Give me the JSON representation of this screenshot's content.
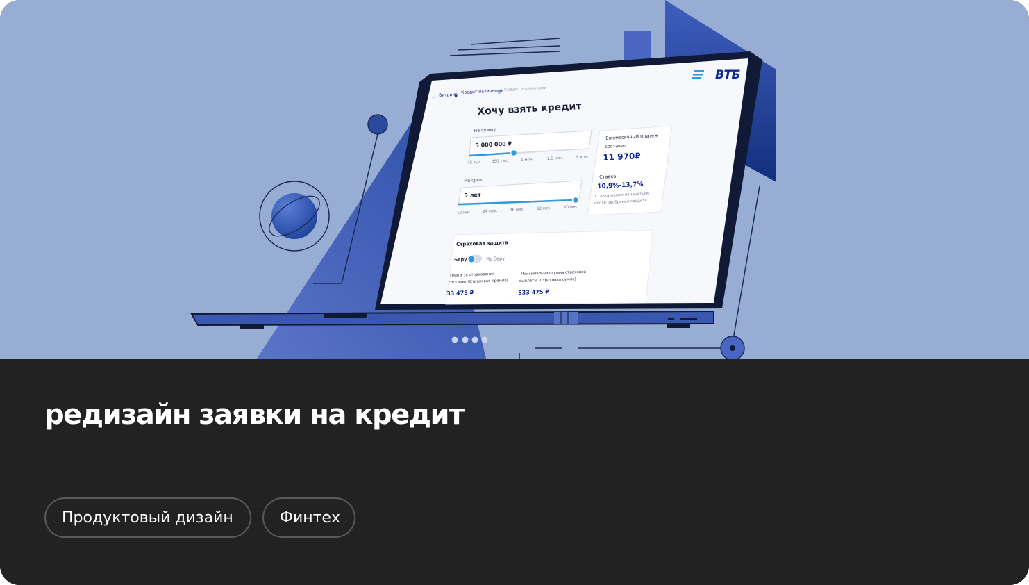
{
  "hero": {
    "brand_logo": "ВТБ",
    "breadcrumb": [
      "Витрина",
      "Кредит наличными",
      "Кредит наличными"
    ],
    "form_title": "Хочу взять кредит",
    "amount": {
      "label": "На сумму",
      "value": "5 000 000 ₽",
      "ticks": [
        "75 тыс.",
        "350 тыс.",
        "1 млн.",
        "2,5 млн.",
        "5 млн."
      ]
    },
    "term": {
      "label": "На срок",
      "value": "5 лет",
      "ticks": [
        "12 мес.",
        "24 мес.",
        "36 мес.",
        "62 мес.",
        "60 мес."
      ]
    },
    "summary": {
      "payment_label_1": "Ежемесячный платеж",
      "payment_label_2": "составит",
      "payment_value": "11 970₽",
      "rate_label": "Ставка",
      "rate_value": "10,9%-13,7%",
      "rate_note_1": "Ставка может измениться",
      "rate_note_2": "после одобрения кредита"
    },
    "insurance": {
      "title": "Страховая защита",
      "toggle_on_label": "Беру",
      "toggle_off_label": "Не беру",
      "fee_label_1": "Плата за страхование",
      "fee_label_2": "составит (Страховая премия)",
      "fee_value": "33 475 ₽",
      "max_label_1": "Максимальная сумма страховой",
      "max_label_2": "выплаты (Страховая сумма)",
      "max_value": "533 475 ₽"
    },
    "carousel": {
      "count": 4,
      "active": 1
    }
  },
  "project": {
    "title": "редизайн заявки на кредит",
    "tags": [
      "Продуктовый дизайн",
      "Финтех"
    ]
  },
  "colors": {
    "hero_bg": "#98add4",
    "card_bg": "#222222",
    "accent_blue": "#0a2896",
    "slider_blue": "#2f9ae0",
    "tag_border": "#5a5a5a"
  }
}
